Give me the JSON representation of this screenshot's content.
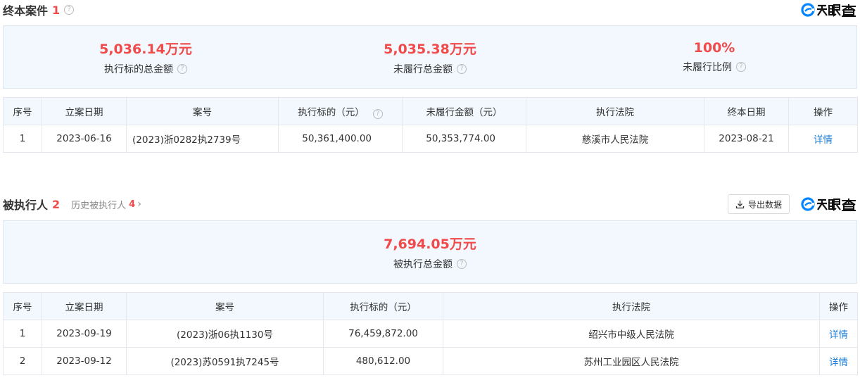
{
  "brand": {
    "name": "天眼查",
    "color": "#0084ff"
  },
  "colors": {
    "accent_red": "#f04a4a",
    "link_blue": "#1c7ed6",
    "panel_bg": "#f2f8fd"
  },
  "terminated": {
    "title": "终本案件",
    "count": "1",
    "help": "?",
    "stats": [
      {
        "value": "5,036.14万元",
        "label": "执行标的总金额"
      },
      {
        "value": "5,035.38万元",
        "label": "未履行总金额"
      },
      {
        "value": "100%",
        "label": "未履行比例"
      }
    ],
    "columns": [
      "序号",
      "立案日期",
      "案号",
      "执行标的（元）",
      "未履行金额（元）",
      "执行法院",
      "终本日期",
      "操作"
    ],
    "rows": [
      {
        "seq": "1",
        "date": "2023-06-16",
        "case_no": "(2023)浙0282执2739号",
        "amount": "50,361,400.00",
        "unpaid": "50,353,774.00",
        "court": "慈溪市人民法院",
        "end_date": "2023-08-21",
        "action": "详情"
      }
    ]
  },
  "executed": {
    "title": "被执行人",
    "count": "2",
    "history_label": "历史被执行人",
    "history_count": "4",
    "export_label": "导出数据",
    "help": "?",
    "stat": {
      "value": "7,694.05万元",
      "label": "被执行总金额"
    },
    "columns": [
      "序号",
      "立案日期",
      "案号",
      "执行标的（元）",
      "执行法院",
      "操作"
    ],
    "rows": [
      {
        "seq": "1",
        "date": "2023-09-19",
        "case_no": "(2023)浙06执1130号",
        "amount": "76,459,872.00",
        "court": "绍兴市中级人民法院",
        "action": "详情"
      },
      {
        "seq": "2",
        "date": "2023-09-12",
        "case_no": "(2023)苏0591执7245号",
        "amount": "480,612.00",
        "court": "苏州工业园区人民法院",
        "action": "详情"
      }
    ]
  }
}
